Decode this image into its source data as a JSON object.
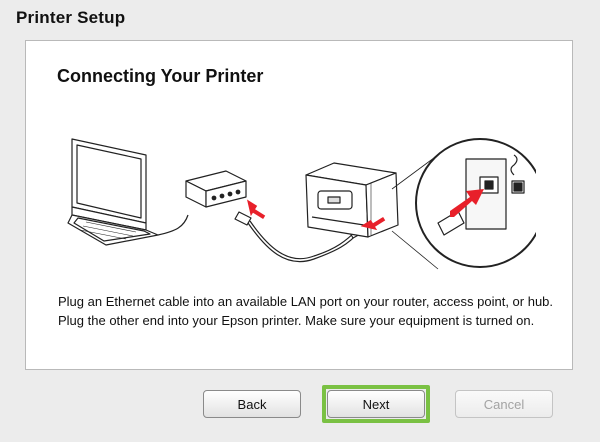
{
  "window": {
    "title": "Printer Setup"
  },
  "page": {
    "heading": "Connecting Your Printer",
    "instructions": "Plug an Ethernet cable into an available LAN port on your router, access point, or hub. Plug the other end into your Epson printer. Make sure your equipment is turned on."
  },
  "buttons": {
    "back": "Back",
    "next": "Next",
    "cancel": "Cancel",
    "cancel_enabled": false,
    "focused": "next"
  },
  "colors": {
    "arrow": "#e8202a",
    "focus_ring": "#7ac143",
    "panel_background": "#ffffff",
    "window_background": "#ececec"
  }
}
